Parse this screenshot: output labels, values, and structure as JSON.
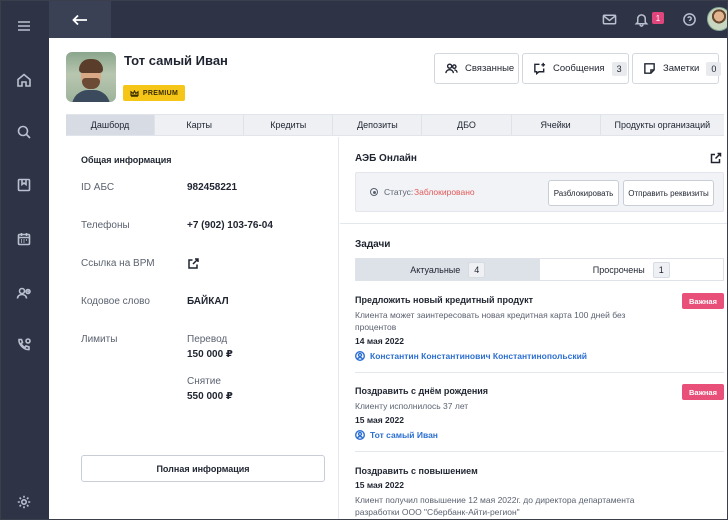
{
  "profile": {
    "name": "Тот самый Иван",
    "badge": "PREMIUM"
  },
  "header_actions": {
    "linked_label": "Связанные",
    "messages_label": "Сообщения",
    "messages_count": "3",
    "notes_label": "Заметки",
    "notes_count": "0"
  },
  "topbar": {
    "notifications_count": "1"
  },
  "tabs": [
    {
      "label": "Дашборд",
      "active": true
    },
    {
      "label": "Карты"
    },
    {
      "label": "Кредиты"
    },
    {
      "label": "Депозиты"
    },
    {
      "label": "ДБО"
    },
    {
      "label": "Ячейки"
    },
    {
      "label": "Продукты организаций"
    }
  ],
  "general": {
    "title": "Общая информация",
    "abs_id_label": "ID АБС",
    "abs_id_value": "982458221",
    "phones_label": "Телефоны",
    "phones_value": "+7 (902) 103-76-04",
    "vrm_label": "Ссылка на ВРМ",
    "code_word_label": "Кодовое слово",
    "code_word_value": "БАЙКАЛ",
    "limits_label": "Лимиты",
    "transfer_label": "Перевод",
    "transfer_value": "150 000 ₽",
    "withdraw_label": "Снятие",
    "withdraw_value": "550 000 ₽",
    "full_info_button": "Полная информация"
  },
  "aeb": {
    "title": "АЭБ Онлайн",
    "status_label": "Статус:",
    "status_value": "Заблокировано",
    "unblock_button": "Разблокировать",
    "send_details_button": "Отправить реквизиты"
  },
  "tasks": {
    "title": "Задачи",
    "tab_current_label": "Актуальные",
    "tab_current_count": "4",
    "tab_overdue_label": "Просрочены",
    "tab_overdue_count": "1",
    "items": [
      {
        "title": "Предложить новый кредитный продукт",
        "description": "Клиента может заинтересовать новая кредитная карта 100 дней без процентов",
        "date": "14 мая 2022",
        "person": "Константин Константинович Константинопольский",
        "badge": "Важная"
      },
      {
        "title": "Поздравить с днём рождения",
        "description": "Клиенту исполнилось 37 лет",
        "date": "15 мая 2022",
        "person": "Тот самый Иван",
        "badge": "Важная"
      },
      {
        "title": "Поздравить с повышением",
        "date": "15 мая 2022",
        "description": "Клиент получил повышение 12 мая 2022г. до директора департамента разработки ООО \"Сбербанк-Айти-регион\""
      }
    ]
  },
  "icons": {
    "sidebar": [
      "menu-icon",
      "home-icon",
      "search-icon",
      "bookmark-icon",
      "calendar-icon",
      "users-icon",
      "phone-icon",
      "settings-icon"
    ],
    "topbar": [
      "back-arrow-icon",
      "mail-icon",
      "bell-icon",
      "help-icon"
    ]
  }
}
